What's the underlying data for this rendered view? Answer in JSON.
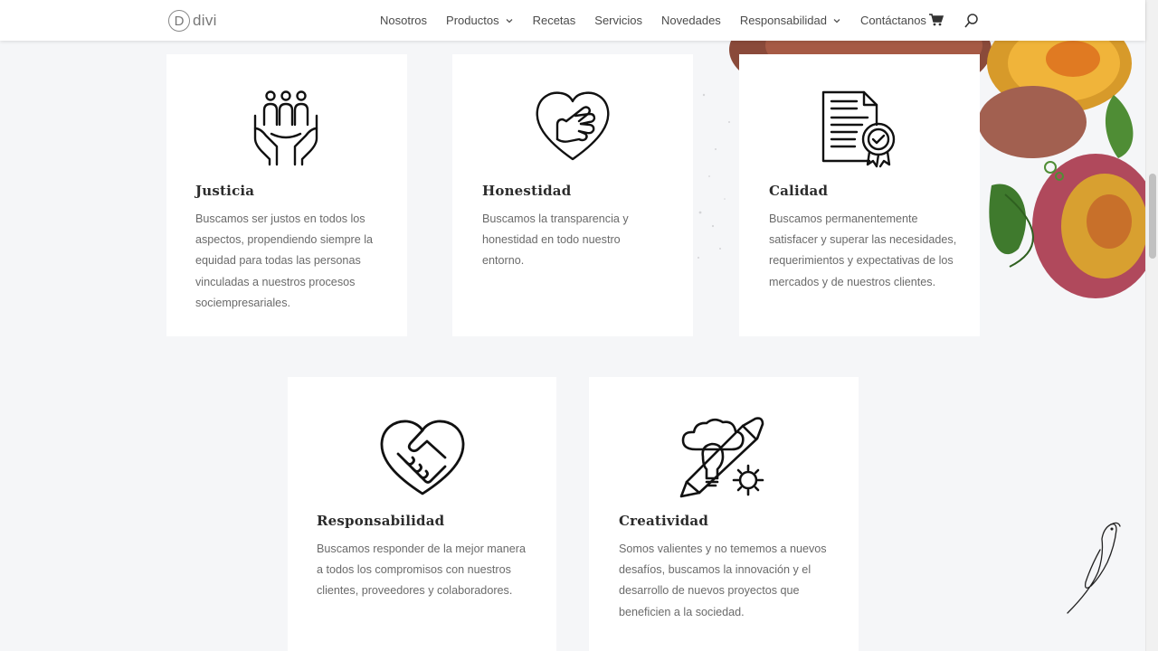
{
  "header": {
    "logo_letter": "D",
    "logo_text": "divi",
    "nav": [
      {
        "label": "Nosotros",
        "dropdown": false
      },
      {
        "label": "Productos",
        "dropdown": true
      },
      {
        "label": "Recetas",
        "dropdown": false
      },
      {
        "label": "Servicios",
        "dropdown": false
      },
      {
        "label": "Novedades",
        "dropdown": false
      },
      {
        "label": "Responsabilidad",
        "dropdown": true
      },
      {
        "label": "Contáctanos",
        "dropdown": false
      }
    ],
    "icons": [
      "cart-icon",
      "search-icon"
    ]
  },
  "values": [
    {
      "title": "Justicia",
      "text": [
        "Buscamos ser justos en todos los",
        "aspectos, propendiendo siempre la",
        "equidad para todas las personas",
        "vinculadas a nuestros procesos",
        "sociempresariales."
      ],
      "icon": "people-in-hands-icon"
    },
    {
      "title": "Honestidad",
      "text": [
        "Buscamos la transparencia y",
        "honestidad en todo nuestro",
        "entorno."
      ],
      "icon": "heart-hand-icon"
    },
    {
      "title": "Calidad",
      "text": [
        "Buscamos permanentemente",
        "satisfacer y superar las necesidades,",
        "requerimientos y expectativas de los",
        "mercados y de nuestros clientes."
      ],
      "icon": "certificate-icon"
    },
    {
      "title": "Responsabilidad",
      "text": [
        "Buscamos responder de la mejor manera",
        "a todos los compromisos con nuestros",
        "clientes, proveedores y colaboradores."
      ],
      "icon": "heart-handshake-icon"
    },
    {
      "title": "Creatividad",
      "text": [
        "Somos valientes y no tememos a nuevos",
        "desafíos, buscamos la innovación y el",
        "desarrollo de nuevos proyectos que",
        "beneficien a la sociedad."
      ],
      "icon": "creative-idea-icon"
    }
  ],
  "colors": {
    "background": "#f5f6f8",
    "card": "#ffffff",
    "title": "#2b2b2b",
    "text": "#6a6a6a",
    "nav": "#4b4b4b"
  }
}
